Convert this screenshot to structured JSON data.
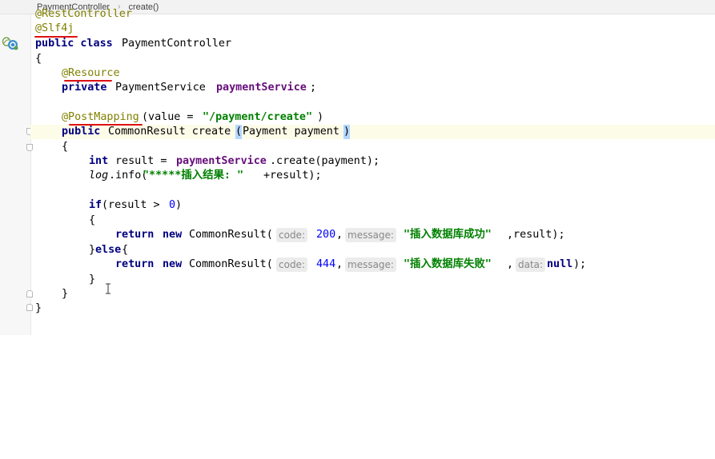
{
  "breadcrumb": {
    "class_name": "PaymentController",
    "method_name": "create()"
  },
  "code": {
    "line0": "@RestController",
    "line1": "@Slf4j",
    "line2_kw": "public class",
    "line2_name": "PaymentController",
    "line3": "{",
    "line4": "@Resource",
    "line5_kw": "private",
    "line5_type": "PaymentService",
    "line5_field": "paymentService",
    "line5_end": ";",
    "line7_ann": "@PostMapping",
    "line7_open": "(value = ",
    "line7_str": "\"/payment/create\"",
    "line7_close": ")",
    "line8_kw": "public",
    "line8_sig": "CommonResult create",
    "line8_paren_open": "(",
    "line8_params": "Payment payment",
    "line8_paren_close": ")",
    "line9": "{",
    "line10_kw": "int",
    "line10_a": "result = ",
    "line10_field": "paymentService",
    "line10_b": ".create(payment);",
    "line11_log": "log",
    "line11_a": ".info(",
    "line11_str": "\"*****插入结果: \"",
    "line11_b": "+result);",
    "line13_kw": "if",
    "line13_a": "(result > ",
    "line13_num": "0",
    "line13_b": ")",
    "line14": "{",
    "line15_kw": "return",
    "line15_new": "new",
    "line15_cls": "CommonResult(",
    "line15_hint1": "code:",
    "line15_num": "200",
    "line15_comma": ",",
    "line15_hint2": "message:",
    "line15_str": "\"插入数据库成功\"",
    "line15_end": ",result);",
    "line16_a": "}",
    "line16_kw": "else",
    "line16_b": "{",
    "line17_kw": "return",
    "line17_new": "new",
    "line17_cls": "CommonResult(",
    "line17_hint1": "code:",
    "line17_num": "444",
    "line17_comma": ",",
    "line17_hint2": "message:",
    "line17_str": "\"插入数据库失败\"",
    "line17_comma2": ",",
    "line17_hint3": "data:",
    "line17_null": "null",
    "line17_end": ");",
    "line18": "}",
    "line19": "}",
    "line20": "}"
  },
  "icons": [
    "spring-bean-icon",
    "class-type-icon",
    "intention-bulb-icon",
    "text-cursor-icon"
  ],
  "colors": {
    "annotation": "#808000",
    "keyword": "#000080",
    "field": "#660e7a",
    "string": "#008000",
    "number": "#0000ff",
    "underline": "#dd1111",
    "current_line": "#fdfce8"
  }
}
